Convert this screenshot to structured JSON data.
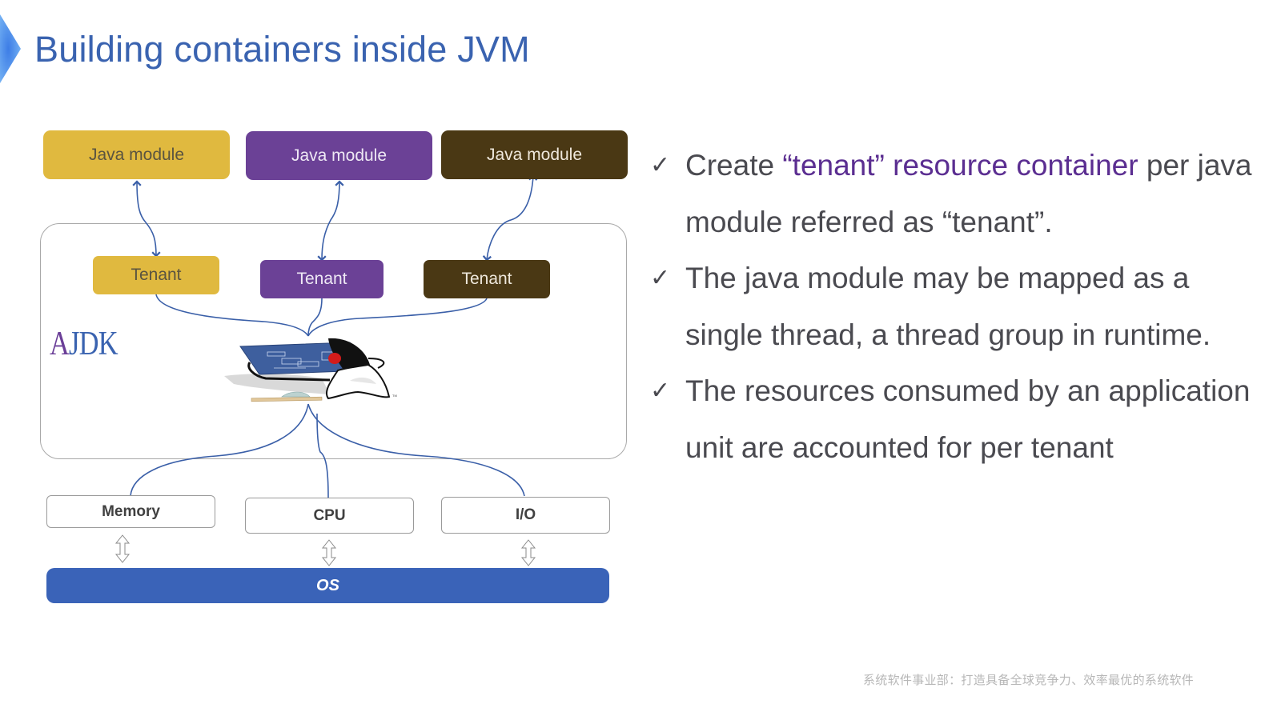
{
  "slide": {
    "title": "Building containers inside JVM",
    "accent_color": "#3a63b0",
    "footer": "系统软件事业部：打造具备全球竞争力、效率最优的系统软件"
  },
  "diagram": {
    "java_modules": [
      {
        "label": "Java module",
        "color": "#e0b93f"
      },
      {
        "label": "Java module",
        "color": "#6b4196"
      },
      {
        "label": "Java module",
        "color": "#4a3814"
      }
    ],
    "tenants": [
      {
        "label": "Tenant",
        "color": "#e0b93f"
      },
      {
        "label": "Tenant",
        "color": "#6b4196"
      },
      {
        "label": "Tenant",
        "color": "#4a3814"
      }
    ],
    "container_label_first": "A",
    "container_label_rest": "JDK",
    "mascot": "duke-graduate-icon",
    "resources": [
      {
        "label": "Memory"
      },
      {
        "label": "CPU"
      },
      {
        "label": "I/O"
      }
    ],
    "os_label": "OS"
  },
  "bullets": [
    {
      "pre": "Create ",
      "highlight": "“tenant” resource container",
      "post": " per java module referred as  “tenant”."
    },
    {
      "pre": "The java module may be mapped as a single thread, a thread group in runtime.",
      "highlight": "",
      "post": ""
    },
    {
      "pre": "The resources consumed by an application unit are accounted for per tenant",
      "highlight": "",
      "post": ""
    }
  ],
  "bullet_icon": "check-mark-icon",
  "bullet_glyph": "✓"
}
